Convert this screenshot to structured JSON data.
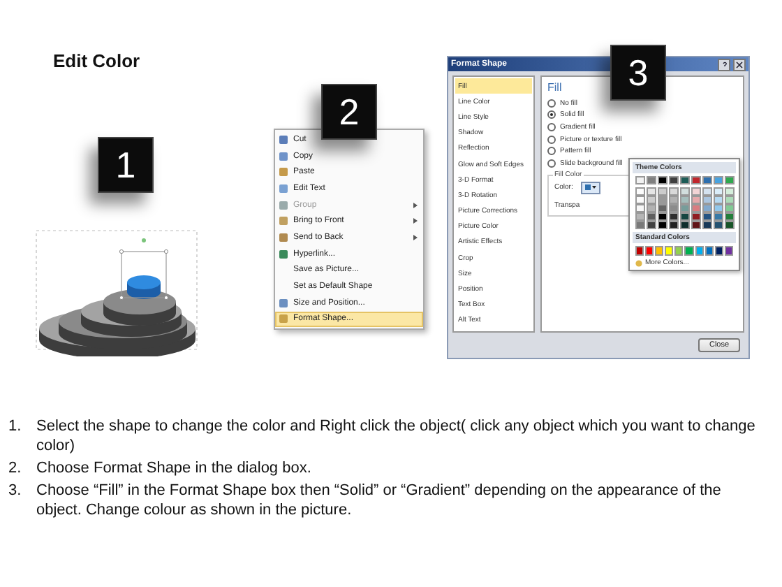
{
  "title": "Edit Color",
  "steps": [
    {
      "label": "1"
    },
    {
      "label": "2"
    },
    {
      "label": "3"
    }
  ],
  "context_menu": {
    "items": [
      {
        "label": "Cut",
        "disabled": false,
        "submenu": false,
        "selected": false
      },
      {
        "label": "Copy",
        "disabled": false,
        "submenu": false,
        "selected": false
      },
      {
        "label": "Paste",
        "disabled": false,
        "submenu": false,
        "selected": false
      },
      {
        "label": "Edit Text",
        "disabled": false,
        "submenu": false,
        "selected": false
      },
      {
        "label": "Group",
        "disabled": true,
        "submenu": true,
        "selected": false
      },
      {
        "label": "Bring to Front",
        "disabled": false,
        "submenu": true,
        "selected": false
      },
      {
        "label": "Send to Back",
        "disabled": false,
        "submenu": true,
        "selected": false
      },
      {
        "label": "Hyperlink...",
        "disabled": false,
        "submenu": false,
        "selected": false
      },
      {
        "label": "Save as Picture...",
        "disabled": false,
        "submenu": false,
        "selected": false
      },
      {
        "label": "Set as Default Shape",
        "disabled": false,
        "submenu": false,
        "selected": false
      },
      {
        "label": "Size and Position...",
        "disabled": false,
        "submenu": false,
        "selected": false
      },
      {
        "label": "Format Shape...",
        "disabled": false,
        "submenu": false,
        "selected": true
      }
    ]
  },
  "dialog": {
    "title": "Format Shape",
    "categories": [
      {
        "label": "Fill",
        "selected": true
      },
      {
        "label": "Line Color",
        "selected": false
      },
      {
        "label": "Line Style",
        "selected": false
      },
      {
        "label": "Shadow",
        "selected": false
      },
      {
        "label": "Reflection",
        "selected": false
      },
      {
        "label": "Glow and Soft Edges",
        "selected": false
      },
      {
        "label": "3-D Format",
        "selected": false
      },
      {
        "label": "3-D Rotation",
        "selected": false
      },
      {
        "label": "Picture Corrections",
        "selected": false
      },
      {
        "label": "Picture Color",
        "selected": false
      },
      {
        "label": "Artistic Effects",
        "selected": false
      },
      {
        "label": "Crop",
        "selected": false
      },
      {
        "label": "Size",
        "selected": false
      },
      {
        "label": "Position",
        "selected": false
      },
      {
        "label": "Text Box",
        "selected": false
      },
      {
        "label": "Alt Text",
        "selected": false
      }
    ],
    "section_title": "Fill",
    "fill_options": [
      {
        "label": "No fill",
        "selected": false
      },
      {
        "label": "Solid fill",
        "selected": true
      },
      {
        "label": "Gradient fill",
        "selected": false
      },
      {
        "label": "Picture or texture fill",
        "selected": false
      },
      {
        "label": "Pattern fill",
        "selected": false
      },
      {
        "label": "Slide background fill",
        "selected": false
      }
    ],
    "fill_color_group": "Fill Color",
    "color_label": "Color:",
    "transparency_label": "Transpa",
    "close_button": "Close",
    "color_popup": {
      "theme_title": "Theme Colors",
      "theme_colors": [
        {
          "color": "#f2f2f2"
        },
        {
          "color": "#7f7f7f"
        },
        {
          "color": "#000000"
        },
        {
          "color": "#3f3f3f"
        },
        {
          "color": "#1d5c57"
        },
        {
          "color": "#c0272d"
        },
        {
          "color": "#2e6fae"
        },
        {
          "color": "#4aa3df"
        },
        {
          "color": "#2fa84f"
        }
      ],
      "standard_title": "Standard Colors",
      "standard_colors": [
        {
          "color": "#c00000"
        },
        {
          "color": "#ff0000"
        },
        {
          "color": "#ffc000"
        },
        {
          "color": "#ffff00"
        },
        {
          "color": "#92d050"
        },
        {
          "color": "#00b050"
        },
        {
          "color": "#00b0f0"
        },
        {
          "color": "#0070c0"
        },
        {
          "color": "#002060"
        },
        {
          "color": "#7030a0"
        }
      ],
      "more_colors": "More Colors..."
    }
  },
  "instructions": [
    {
      "number": "1.",
      "text": "Select the shape to change the color and Right click the object( click any object which you want to change color)"
    },
    {
      "number": "2.",
      "text": "Choose Format Shape in the dialog box."
    },
    {
      "number": "3.",
      "text": "Choose “Fill” in the Format Shape box then “Solid” or “Gradient” depending on the appearance of the object. Change colour as shown in the picture."
    }
  ]
}
